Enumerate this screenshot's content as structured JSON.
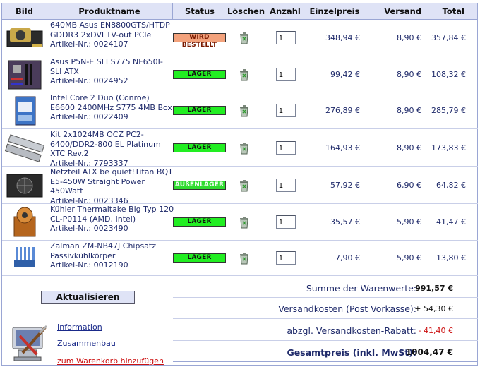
{
  "table": {
    "headers": {
      "bild": "Bild",
      "produktname": "Produktname",
      "status": "Status",
      "loeschen": "Löschen",
      "anzahl": "Anzahl",
      "einzelpreis": "Einzelpreis",
      "versand": "Versand",
      "total": "Total"
    },
    "rows": [
      {
        "name": "640MB Asus EN8800GTS/HTDP GDDR3 2xDVI TV-out PCIe",
        "article": "Artikel-Nr.: 0024107",
        "status": "WIRD BESTELLT",
        "status_kind": "bestellt",
        "qty": "1",
        "unit_price": "348,94 €",
        "shipping": "8,90 €",
        "total": "357,84 €",
        "thumb_icon": "graphics-card-image"
      },
      {
        "name": "Asus P5N-E SLI S775 NF650I-SLI ATX",
        "article": "Artikel-Nr.: 0024952",
        "status": "LAGER",
        "status_kind": "lager",
        "qty": "1",
        "unit_price": "99,42 €",
        "shipping": "8,90 €",
        "total": "108,32 €",
        "thumb_icon": "motherboard-image"
      },
      {
        "name": "Intel Core 2 Duo (Conroe) E6600 2400MHz S775 4MB Box",
        "article": "Artikel-Nr.: 0022409",
        "status": "LAGER",
        "status_kind": "lager",
        "qty": "1",
        "unit_price": "276,89 €",
        "shipping": "8,90 €",
        "total": "285,79 €",
        "thumb_icon": "cpu-box-image"
      },
      {
        "name": "Kit 2x1024MB OCZ PC2-6400/DDR2-800 EL Platinum XTC Rev.2",
        "article": "Artikel-Nr.: 7793337",
        "status": "LAGER",
        "status_kind": "lager",
        "qty": "1",
        "unit_price": "164,93 €",
        "shipping": "8,90 €",
        "total": "173,83 €",
        "thumb_icon": "ram-image"
      },
      {
        "name": "Netzteil ATX be quiet!Titan BQT E5-450W Straight Power 450Watt",
        "article": "Artikel-Nr.: 0023346",
        "status": "AUßENLAGER",
        "status_kind": "aussen",
        "qty": "1",
        "unit_price": "57,92 €",
        "shipping": "6,90 €",
        "total": "64,82 €",
        "thumb_icon": "power-supply-image"
      },
      {
        "name": "Kühler Thermaltake Big Typ 120 CL-P0114 (AMD, Intel)",
        "article": "Artikel-Nr.: 0023490",
        "status": "LAGER",
        "status_kind": "lager",
        "qty": "1",
        "unit_price": "35,57 €",
        "shipping": "5,90 €",
        "total": "41,47 €",
        "thumb_icon": "cpu-cooler-image"
      },
      {
        "name": "Zalman ZM-NB47J Chipsatz Passivkühlkörper",
        "article": "Artikel-Nr.: 0012190",
        "status": "LAGER",
        "status_kind": "lager",
        "qty": "1",
        "unit_price": "7,90 €",
        "shipping": "5,90 €",
        "total": "13,80 €",
        "thumb_icon": "chipset-heatsink-image"
      }
    ]
  },
  "summary": {
    "update_button": "Aktualisieren",
    "subtotal_label": "Summe der Warenwerte:",
    "subtotal_value": "991,57 €",
    "shipping_label": "Versandkosten (Post Vorkasse):",
    "shipping_value": "+ 54,30 €",
    "discount_label": "abzgl. Versandkosten-Rabatt:",
    "discount_value": "- 41,40 €",
    "grand_label": "Gesamtpreis (inkl. MwSt):",
    "grand_value": "1004,47 €"
  },
  "links": {
    "info": "Information",
    "assembly": "Zusammenbau",
    "add_cart": "zum Warenkorb hinzufügen"
  },
  "colors": {
    "header_bg": "#dfe3f6",
    "lager": "#22ee22",
    "bestellt": "#f3a27c",
    "discount": "#cc1111"
  }
}
